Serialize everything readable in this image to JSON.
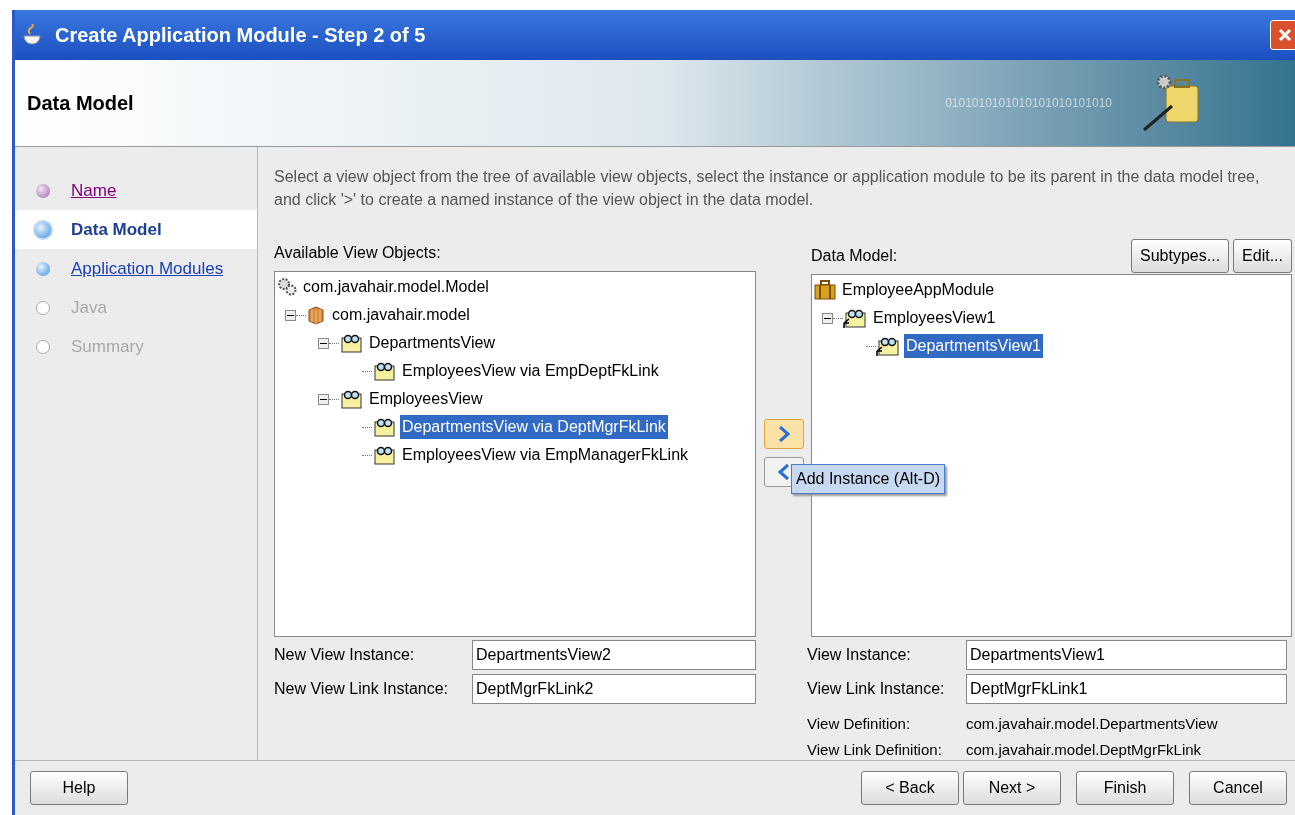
{
  "window": {
    "title": "Create Application Module - Step 2 of 5"
  },
  "header": {
    "title": "Data Model",
    "decoration": "0101010101010101010101010"
  },
  "steps": [
    {
      "label": "Name",
      "kind": "visited",
      "selected": false
    },
    {
      "label": "Data Model",
      "kind": "current",
      "selected": true
    },
    {
      "label": "Application Modules",
      "kind": "link",
      "selected": false
    },
    {
      "label": "Java",
      "kind": "disabled",
      "selected": false
    },
    {
      "label": "Summary",
      "kind": "disabled",
      "selected": false
    }
  ],
  "instructions": "Select a view object from the tree of available view objects, select the instance or application module to be its parent in the data model tree, and click '>' to create a named instance of the view object in the data model.",
  "available": {
    "label": "Available View Objects:",
    "tree": [
      {
        "label": "com.javahair.model.Model",
        "kind": "model",
        "selected": false,
        "children": [
          {
            "label": "com.javahair.model",
            "kind": "package",
            "expanded": true,
            "selected": false,
            "children": [
              {
                "label": "DepartmentsView",
                "kind": "view",
                "expanded": true,
                "selected": false,
                "children": [
                  {
                    "label": "EmployeesView via EmpDeptFkLink",
                    "kind": "view",
                    "selected": false
                  }
                ]
              },
              {
                "label": "EmployeesView",
                "kind": "view",
                "expanded": true,
                "selected": false,
                "children": [
                  {
                    "label": "DepartmentsView via DeptMgrFkLink",
                    "kind": "view",
                    "selected": true
                  },
                  {
                    "label": "EmployeesView via EmpManagerFkLink",
                    "kind": "view",
                    "selected": false
                  }
                ]
              }
            ]
          }
        ]
      }
    ]
  },
  "transfer_buttons": [
    {
      "kind": "add",
      "hovered": true
    },
    {
      "kind": "remove",
      "hovered": false
    }
  ],
  "tooltip": "Add Instance (Alt-D)",
  "data_model": {
    "label": "Data Model:",
    "buttons": [
      "Subtypes...",
      "Edit..."
    ],
    "tree": [
      {
        "label": "EmployeeAppModule",
        "kind": "module",
        "selected": false,
        "children": [
          {
            "label": "EmployeesView1",
            "kind": "instance",
            "expanded": true,
            "selected": false,
            "children": [
              {
                "label": "DepartmentsView1",
                "kind": "instance",
                "selected": true
              }
            ]
          }
        ]
      }
    ]
  },
  "left_fields": [
    {
      "label": "New View Instance:",
      "value": "DepartmentsView2"
    },
    {
      "label": "New View Link Instance:",
      "value": "DeptMgrFkLink2"
    }
  ],
  "right_fields": [
    {
      "label": "View Instance:",
      "value": "DepartmentsView1"
    },
    {
      "label": "View Link Instance:",
      "value": "DeptMgrFkLink1"
    }
  ],
  "definitions": [
    {
      "label": "View Definition:",
      "value": "com.javahair.model.DepartmentsView"
    },
    {
      "label": "View Link Definition:",
      "value": "com.javahair.model.DeptMgrFkLink"
    }
  ],
  "footer": {
    "help": "Help",
    "buttons": [
      "< Back",
      "Next >",
      "Finish",
      "Cancel"
    ]
  }
}
